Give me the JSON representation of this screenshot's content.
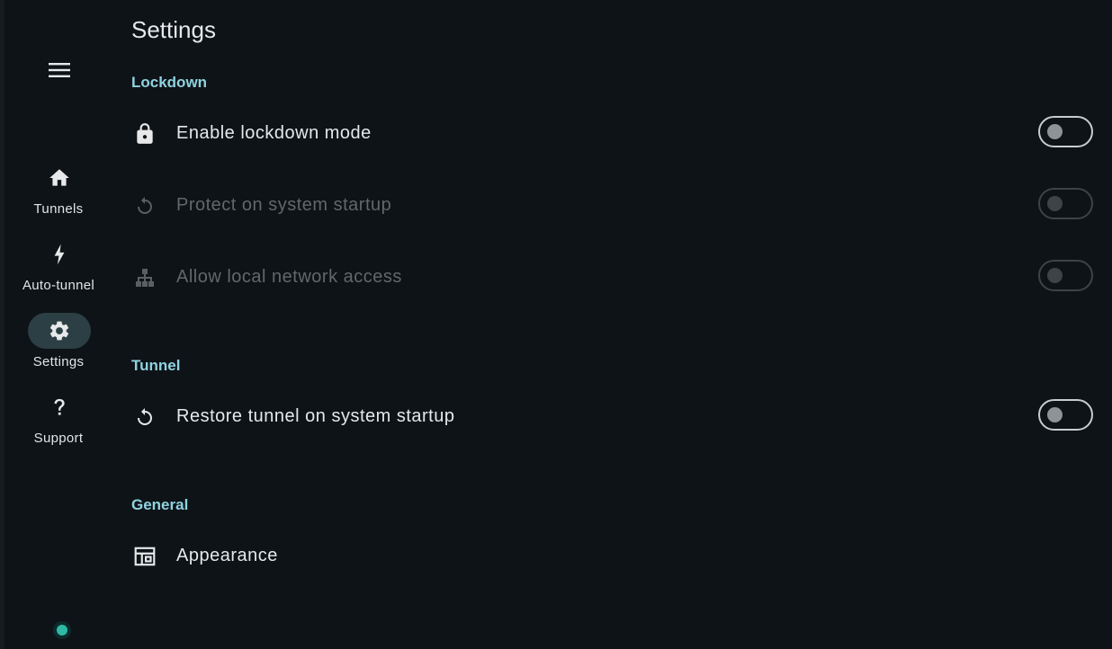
{
  "rail": {
    "menu_icon": "hamburger-menu-icon",
    "items": [
      {
        "label": "Tunnels",
        "icon": "home-icon",
        "active": false
      },
      {
        "label": "Auto-tunnel",
        "icon": "bolt-icon",
        "active": false
      },
      {
        "label": "Settings",
        "icon": "gear-icon",
        "active": true
      },
      {
        "label": "Support",
        "icon": "question-mark-icon",
        "active": false
      }
    ],
    "status_color": "#2fb9a4"
  },
  "page": {
    "title": "Settings"
  },
  "sections": {
    "lockdown": {
      "header": "Lockdown",
      "rows": [
        {
          "label": "Enable lockdown mode",
          "icon": "lock-icon",
          "toggle_on": false,
          "enabled": true
        },
        {
          "label": "Protect on system startup",
          "icon": "restart-icon",
          "toggle_on": false,
          "enabled": false
        },
        {
          "label": "Allow local network access",
          "icon": "network-tree-icon",
          "toggle_on": false,
          "enabled": false
        }
      ]
    },
    "tunnel": {
      "header": "Tunnel",
      "rows": [
        {
          "label": "Restore tunnel on system startup",
          "icon": "restart-icon",
          "toggle_on": false,
          "enabled": true
        }
      ]
    },
    "general": {
      "header": "General",
      "rows": [
        {
          "label": "Appearance",
          "icon": "layout-icon"
        }
      ]
    }
  },
  "colors": {
    "background": "#0e1317",
    "accent": "#8fd3e0",
    "active_pill": "#2c3f44"
  }
}
